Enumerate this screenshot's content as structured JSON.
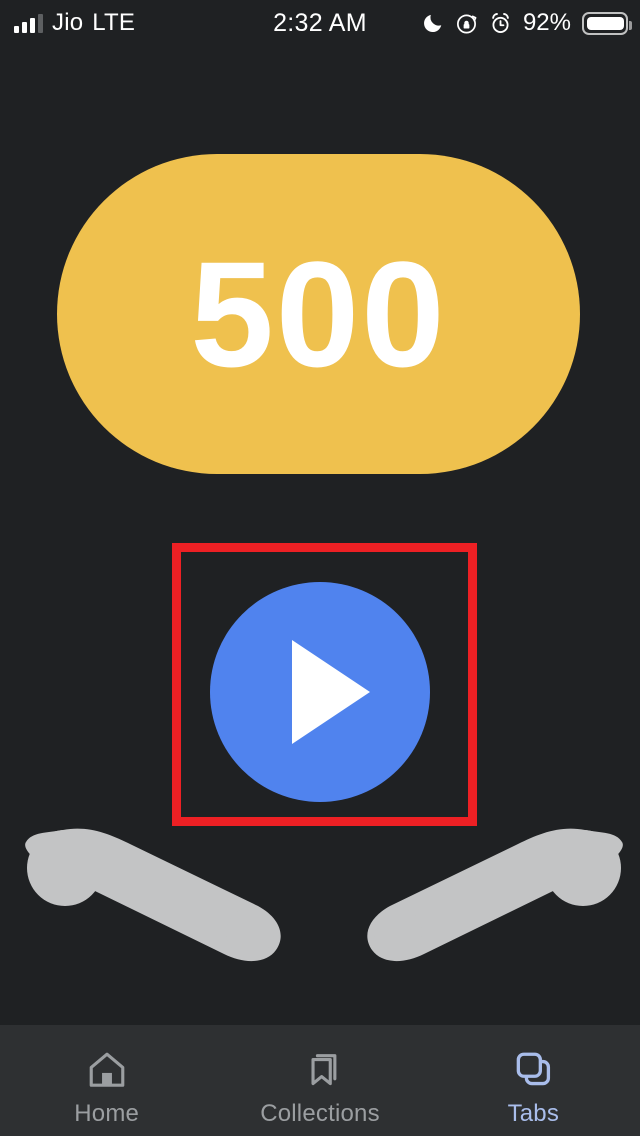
{
  "status_bar": {
    "carrier": "Jio",
    "network": "LTE",
    "time": "2:32 AM",
    "battery_percent": "92%",
    "icons": {
      "signal": "signal-bars-icon",
      "dnd": "moon-icon",
      "rotation_lock": "rotation-lock-icon",
      "alarm": "alarm-clock-icon",
      "battery": "battery-icon"
    }
  },
  "main": {
    "score_pill": {
      "value": "500",
      "background_color": "#efc14e",
      "text_color": "#ffffff"
    },
    "play_button": {
      "icon": "play-triangle-icon",
      "background_color": "#5083ee",
      "icon_color": "#ffffff"
    },
    "highlight": {
      "color": "#ed2024",
      "target": "play-button"
    },
    "flippers": {
      "color": "#c3c4c5",
      "left": "flipper-left-shape",
      "right": "flipper-right-shape"
    },
    "background_color": "#1f2123"
  },
  "bottom_nav": {
    "background_color": "#2e3032",
    "inactive_color": "#9b9ea1",
    "active_color": "#a9bdeb",
    "items": [
      {
        "label": "Home",
        "icon": "home-icon",
        "active": false
      },
      {
        "label": "Collections",
        "icon": "bookmark-icon",
        "active": false
      },
      {
        "label": "Tabs",
        "icon": "tabs-stack-icon",
        "active": true
      }
    ]
  }
}
